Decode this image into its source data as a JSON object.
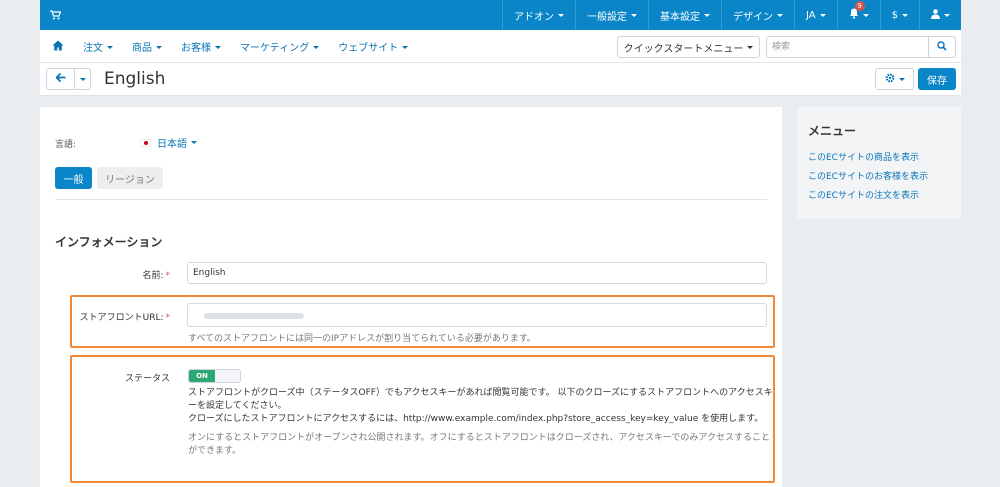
{
  "topbar": {
    "cart_icon": "cart-icon",
    "items": [
      {
        "label": "アドオン"
      },
      {
        "label": "一般設定"
      },
      {
        "label": "基本設定"
      },
      {
        "label": "デザイン"
      },
      {
        "label": "JA"
      }
    ],
    "notifications_count": "9",
    "currency": "$",
    "user_icon": "user-icon"
  },
  "subnav": {
    "home_icon": "home-icon",
    "items": [
      {
        "label": "注文"
      },
      {
        "label": "商品"
      },
      {
        "label": "お客様"
      },
      {
        "label": "マーケティング"
      },
      {
        "label": "ウェブサイト"
      }
    ],
    "quick_start_label": "クイックスタートメニュー",
    "search_placeholder": "検索"
  },
  "titlebar": {
    "title": "English",
    "save_label": "保存"
  },
  "form": {
    "language_label": "言語:",
    "language_value": "日本語",
    "tabs": [
      {
        "label": "一般",
        "active": true
      },
      {
        "label": "リージョン",
        "active": false
      }
    ],
    "section_title": "インフォメーション",
    "name_label": "名前:",
    "name_value": "English",
    "url_label": "ストアフロントURL:",
    "url_help": "すべてのストアフロントには同一のIPアドレスが割り当てられている必要があります。",
    "status_label": "ステータス",
    "status_toggle": "ON",
    "status_desc_1": "ストアフロントがクローズ中（ステータスOFF）でもアクセスキーがあれば閲覧可能です。 以下のクローズにするストアフロントへのアクセスキーを設定してください。",
    "status_desc_2": "クローズにしたストアフロントにアクセスするには、http://www.example.com/index.php?store_access_key=key_value を使用します。",
    "status_help": "オンにするとストアフロントがオープンされ公開されます。オフにするとストアフロントはクローズされ、アクセスキーでのみアクセスすることができます。"
  },
  "sidemenu": {
    "title": "メニュー",
    "links": [
      {
        "label": "このECサイトの商品を表示"
      },
      {
        "label": "このECサイトのお客様を表示"
      },
      {
        "label": "このECサイトの注文を表示"
      }
    ]
  },
  "colors": {
    "primary": "#0a86c8",
    "link": "#0a74b8",
    "highlight": "#f08a3a",
    "toggle_on": "#2ca673",
    "required": "#d9534f"
  }
}
